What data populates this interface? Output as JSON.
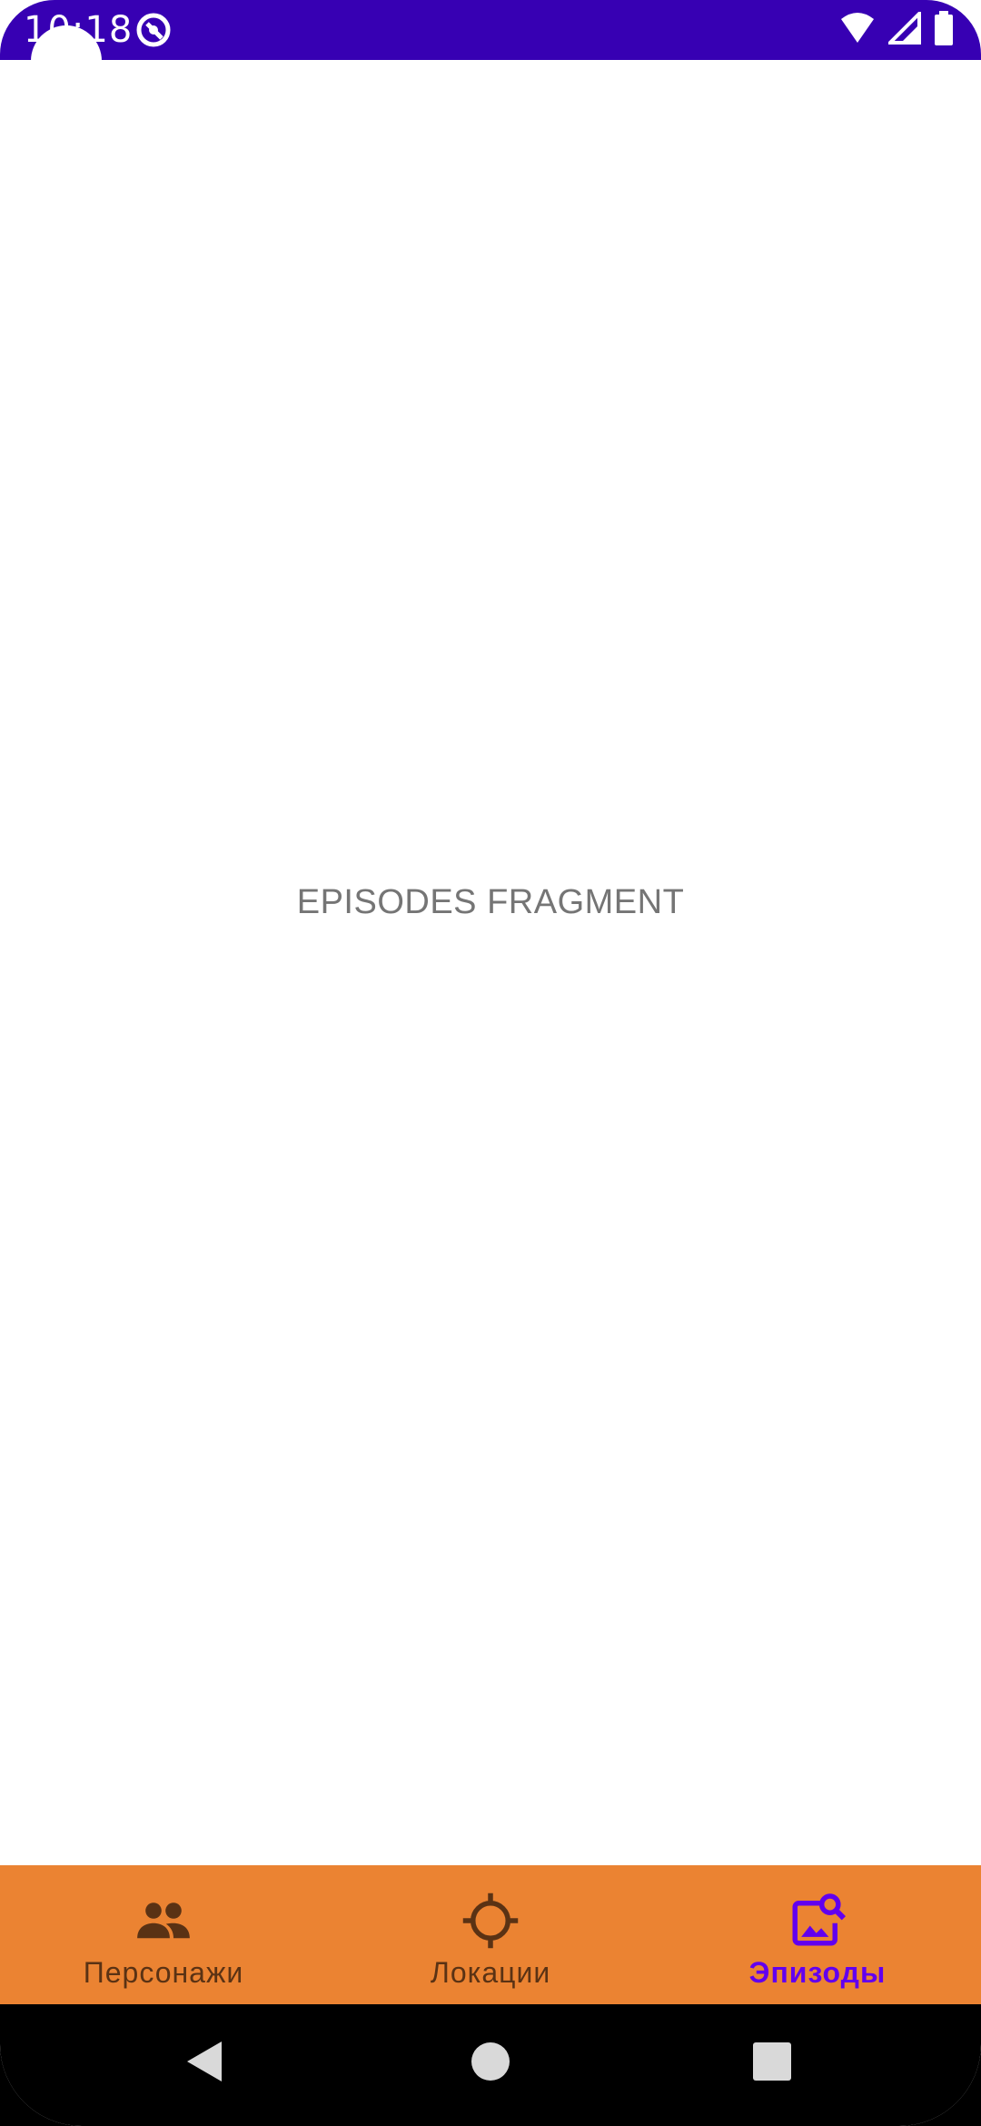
{
  "status_bar": {
    "time": "10:18",
    "background": "#3700B3",
    "icons": [
      "app-notification-icon",
      "wifi-icon",
      "signal-icon",
      "battery-icon"
    ]
  },
  "content": {
    "fragment_label": "EPISODES FRAGMENT",
    "text_color": "#757575"
  },
  "bottom_nav": {
    "background": "#EB8332",
    "active_color": "#6200EE",
    "inactive_color": "#5a3214",
    "items": [
      {
        "label": "Персонажи",
        "icon": "people-icon",
        "active": false
      },
      {
        "label": "Локации",
        "icon": "location-target-icon",
        "active": false
      },
      {
        "label": "Эпизоды",
        "icon": "image-search-icon",
        "active": true
      }
    ]
  },
  "system_nav": {
    "buttons": [
      "back-icon",
      "home-icon",
      "recents-icon"
    ]
  }
}
